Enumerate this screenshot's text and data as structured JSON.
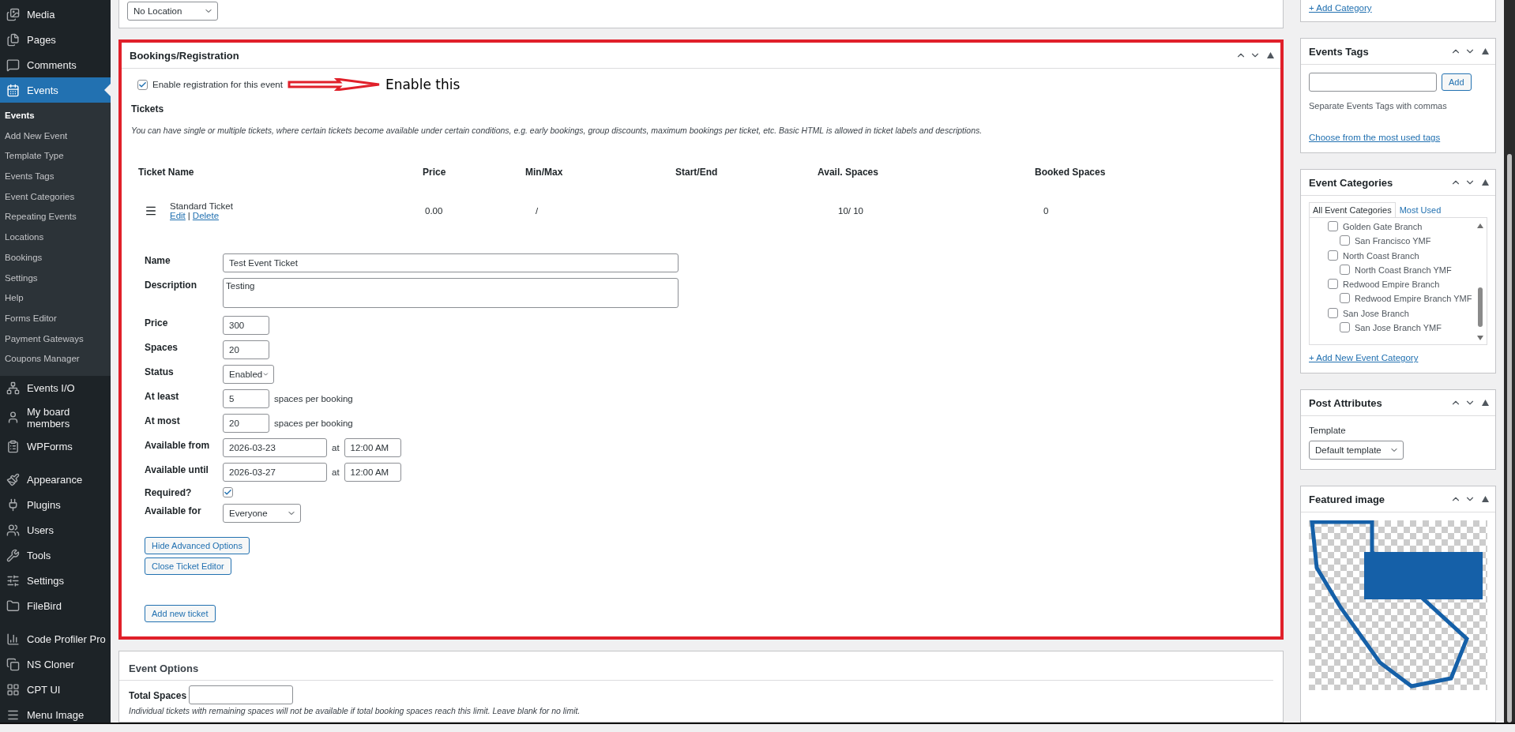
{
  "sidebar": {
    "groups": [
      {
        "items": [
          {
            "label": "Media",
            "selected": false
          },
          {
            "label": "Pages",
            "selected": false
          },
          {
            "label": "Comments",
            "selected": false
          },
          {
            "label": "Events",
            "selected": true,
            "submenu": [
              {
                "label": "Events",
                "selected": true
              },
              {
                "label": "Add New Event",
                "selected": false
              },
              {
                "label": "Template Type",
                "selected": false
              },
              {
                "label": "Events Tags",
                "selected": false
              },
              {
                "label": "Event Categories",
                "selected": false
              },
              {
                "label": "Repeating Events",
                "selected": false
              },
              {
                "label": "Locations",
                "selected": false
              },
              {
                "label": "Bookings",
                "selected": false
              },
              {
                "label": "Settings",
                "selected": false
              },
              {
                "label": "Help",
                "selected": false
              },
              {
                "label": "Forms Editor",
                "selected": false
              },
              {
                "label": "Payment Gateways",
                "selected": false
              },
              {
                "label": "Coupons Manager",
                "selected": false
              }
            ]
          },
          {
            "label": "Events I/O",
            "selected": false
          },
          {
            "label": "My board members",
            "selected": false
          },
          {
            "label": "WPForms",
            "selected": false
          }
        ]
      },
      {
        "items": [
          {
            "label": "Appearance",
            "selected": false
          },
          {
            "label": "Plugins",
            "selected": false
          },
          {
            "label": "Users",
            "selected": false
          },
          {
            "label": "Tools",
            "selected": false
          },
          {
            "label": "Settings",
            "selected": false
          },
          {
            "label": "FileBird",
            "selected": false
          }
        ]
      },
      {
        "items": [
          {
            "label": "Code Profiler Pro",
            "selected": false
          },
          {
            "label": "NS Cloner",
            "selected": false
          },
          {
            "label": "CPT UI",
            "selected": false
          },
          {
            "label": "Menu Image",
            "selected": false
          }
        ]
      }
    ]
  },
  "location_select": {
    "value": "No Location"
  },
  "bookings": {
    "title": "Bookings/Registration",
    "enable_registration": {
      "label": "Enable registration for this event",
      "checked": true
    },
    "annotation": "Enable this",
    "tickets_heading": "Tickets",
    "help": "You can have single or multiple tickets, where certain tickets become available under certain conditions, e.g. early bookings, group discounts, maximum bookings per ticket, etc. Basic HTML is allowed in ticket labels and descriptions.",
    "columns": [
      "Ticket Name",
      "Price",
      "Min/Max",
      "Start/End",
      "Avail. Spaces",
      "Booked Spaces"
    ],
    "tickets": [
      {
        "name": "Standard Ticket",
        "edit": "Edit",
        "separator": "|",
        "delete": "Delete",
        "price": "0.00",
        "min_max": "/",
        "avail": "10/ 10",
        "booked": "0"
      }
    ],
    "editor": {
      "fields": [
        {
          "kind": "text",
          "label": "Name",
          "value": "Test Event Ticket"
        },
        {
          "kind": "textarea",
          "label": "Description",
          "value": "Testing"
        },
        {
          "kind": "short",
          "label": "Price",
          "value": "300"
        },
        {
          "kind": "short",
          "label": "Spaces",
          "value": "20"
        },
        {
          "kind": "select",
          "label": "Status",
          "value": "Enabled"
        },
        {
          "kind": "short",
          "label": "At least",
          "value": "5",
          "suffix": "spaces per booking"
        },
        {
          "kind": "short",
          "label": "At most",
          "value": "20",
          "suffix": "spaces per booking"
        },
        {
          "kind": "datetime",
          "label": "Available from",
          "date": "2026-03-23",
          "at": "at",
          "time": "12:00 AM"
        },
        {
          "kind": "datetime",
          "label": "Available until",
          "date": "2026-03-27",
          "at": "at",
          "time": "12:00 AM"
        },
        {
          "kind": "checkbox",
          "label": "Required?",
          "checked": true
        },
        {
          "kind": "wideselect",
          "label": "Available for",
          "value": "Everyone"
        }
      ],
      "buttons": [
        "Hide Advanced Options",
        "Close Ticket Editor"
      ]
    },
    "add_button": "Add new ticket"
  },
  "event_options": {
    "title": "Event Options",
    "total_spaces_label": "Total Spaces",
    "help": "Individual tickets with remaining spaces will not be available if total booking spaces reach this limit. Leave blank for no limit."
  },
  "side": {
    "add_category_link": "+ Add Category",
    "tags": {
      "title": "Events Tags",
      "add_button": "Add",
      "hint": "Separate Events Tags with commas",
      "link": "Choose from the most used tags"
    },
    "categories": {
      "title": "Event Categories",
      "tabs": [
        {
          "label": "All Event Categories",
          "selected": true
        },
        {
          "label": "Most Used",
          "selected": false
        }
      ],
      "items": [
        {
          "label": "Golden Gate Branch",
          "checked": false,
          "children": [
            {
              "label": "San Francisco YMF",
              "checked": false
            }
          ]
        },
        {
          "label": "North Coast Branch",
          "checked": false,
          "children": [
            {
              "label": "North Coast Branch YMF",
              "checked": false
            }
          ]
        },
        {
          "label": "Redwood Empire Branch",
          "checked": false,
          "children": [
            {
              "label": "Redwood Empire Branch YMF",
              "checked": false
            }
          ]
        },
        {
          "label": "San Jose Branch",
          "checked": false,
          "children": [
            {
              "label": "San Jose Branch YMF",
              "checked": false
            }
          ]
        }
      ],
      "add_link": "+ Add New Event Category"
    },
    "post_attributes": {
      "title": "Post Attributes",
      "template_label": "Template",
      "template_value": "Default template"
    },
    "featured_image": {
      "title": "Featured image"
    }
  }
}
